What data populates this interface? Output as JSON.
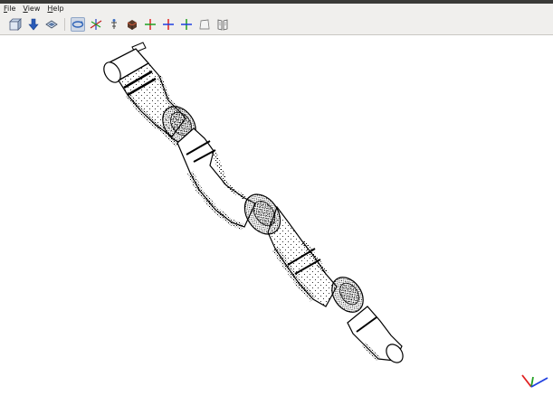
{
  "menubar": {
    "items": [
      {
        "mnemonic": "F",
        "rest": "ile"
      },
      {
        "mnemonic": "V",
        "rest": "iew"
      },
      {
        "mnemonic": "H",
        "rest": "elp"
      }
    ]
  },
  "toolbar": {
    "icons": [
      "open-file-icon",
      "download-icon",
      "layers-icon",
      "rotate-view-icon",
      "axes-snap-icon",
      "transform-icon",
      "solid-shading-icon",
      "view-axis-x-icon",
      "view-axis-y-icon",
      "view-axis-z-icon",
      "perspective-icon",
      "book-icon"
    ],
    "active": "rotate-view-icon"
  },
  "viewport": {
    "model": "robot-arm-wireframe",
    "axis_colors": {
      "x": "#e02020",
      "y": "#20a020",
      "z": "#2040e0"
    }
  }
}
